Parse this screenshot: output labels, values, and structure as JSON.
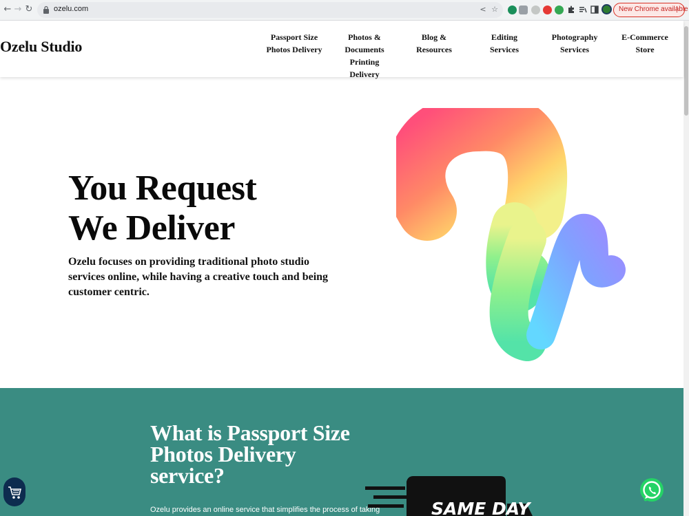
{
  "browser": {
    "url": "ozelu.com",
    "update_label": "New Chrome available",
    "accent": "#d93025"
  },
  "site": {
    "logo": "Ozelu Studio",
    "nav": [
      "Passport Size\nPhotos Delivery",
      "Photos &\nDocuments Printing\nDelivery",
      "Blog &\nResources",
      "Editing\nServices",
      "Photography\nServices",
      "E-Commerce\nStore"
    ]
  },
  "hero": {
    "title_line1": "You Request",
    "title_line2": "We Deliver",
    "description": "Ozelu focuses on providing traditional photo studio services online, while having a creative touch and being customer centric."
  },
  "section": {
    "title": "What is Passport Size Photos Delivery service?",
    "text": "Ozelu provides an online service that simplifies the process of taking",
    "badge_text": "SAME DAY",
    "background": "#3a8c82"
  },
  "widgets": {
    "cart_icon": "shopping-cart-icon",
    "chat_icon": "whatsapp-icon"
  }
}
